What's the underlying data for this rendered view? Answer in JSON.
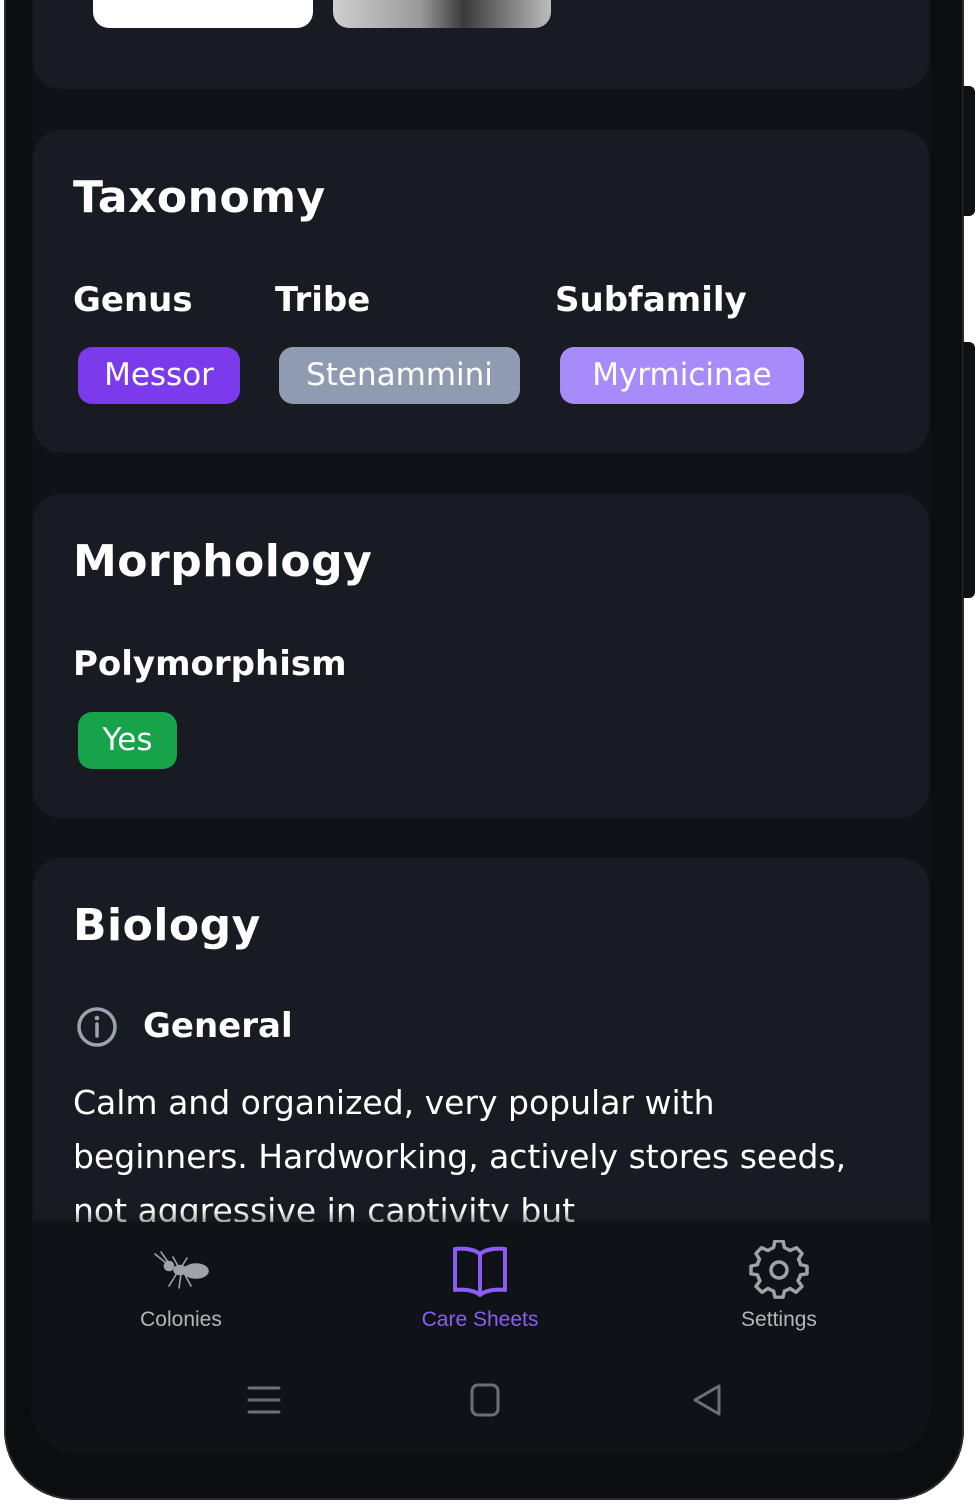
{
  "taxonomy": {
    "title": "Taxonomy",
    "genus_label": "Genus",
    "genus_value": "Messor",
    "tribe_label": "Tribe",
    "tribe_value": "Stenammini",
    "subfamily_label": "Subfamily",
    "subfamily_value": "Myrmicinae"
  },
  "morphology": {
    "title": "Morphology",
    "polymorphism_label": "Polymorphism",
    "polymorphism_value": "Yes"
  },
  "biology": {
    "title": "Biology",
    "general_label": "General",
    "general_text": "Calm and organized, very popular with beginners. Hardworking, actively stores seeds, not aggressive in captivity but"
  },
  "bottom_nav": {
    "items": [
      {
        "label": "Colonies",
        "icon": "ant-icon",
        "active": false
      },
      {
        "label": "Care Sheets",
        "icon": "book-icon",
        "active": true
      },
      {
        "label": "Settings",
        "icon": "gear-icon",
        "active": false
      }
    ]
  },
  "colors": {
    "genus_chip": "#7c3aed",
    "tribe_chip": "#8f9bb0",
    "subfamily_chip": "#a78bfa",
    "yes_chip": "#16a34a",
    "accent": "#8b5cf6",
    "card_bg": "#181c22"
  }
}
